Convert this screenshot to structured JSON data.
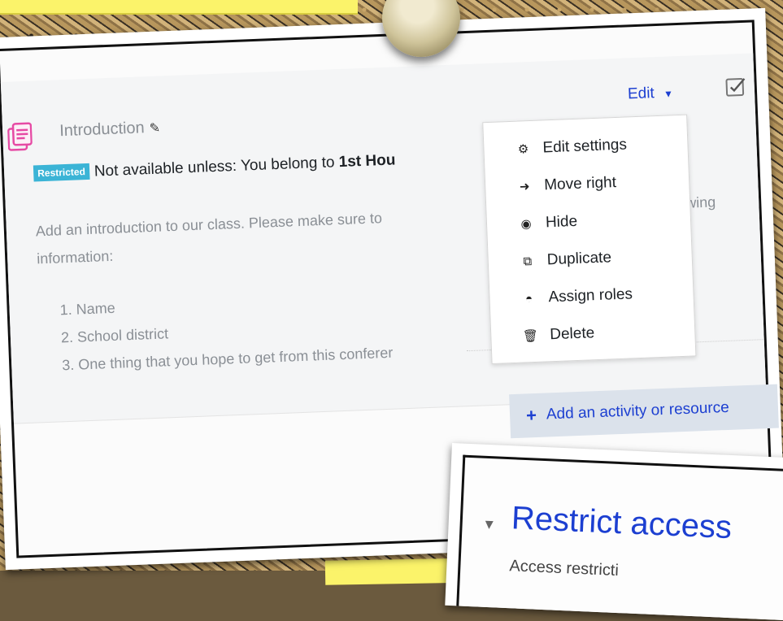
{
  "section": {
    "title": "Introduction",
    "restriction_badge": "Restricted",
    "restriction_text": "Not available unless: You belong to ",
    "restriction_group": "1st Hou",
    "description_line1": "Add an introduction to our class. Please make sure to",
    "description_tail": "wing",
    "description_line2": "information:",
    "list_items": [
      "1. Name",
      "2. School district",
      "3. One thing that you hope to get from this conferer"
    ],
    "edit_label": "Edit",
    "add_activity_label": "Add an activity or resource"
  },
  "edit_menu": {
    "items": [
      {
        "label": "Edit settings",
        "icon": "gear-icon"
      },
      {
        "label": "Move right",
        "icon": "arrow-right-icon"
      },
      {
        "label": "Hide",
        "icon": "eye-icon"
      },
      {
        "label": "Duplicate",
        "icon": "duplicate-icon"
      },
      {
        "label": "Assign roles",
        "icon": "user-circle-icon"
      },
      {
        "label": "Delete",
        "icon": "trash-icon"
      }
    ]
  },
  "restrict_panel": {
    "title": "Restrict access",
    "subtitle": "Access restricti"
  },
  "colors": {
    "link": "#1c3fd1",
    "badge": "#3bb4d6",
    "activity_icon": "#e64aa4"
  }
}
